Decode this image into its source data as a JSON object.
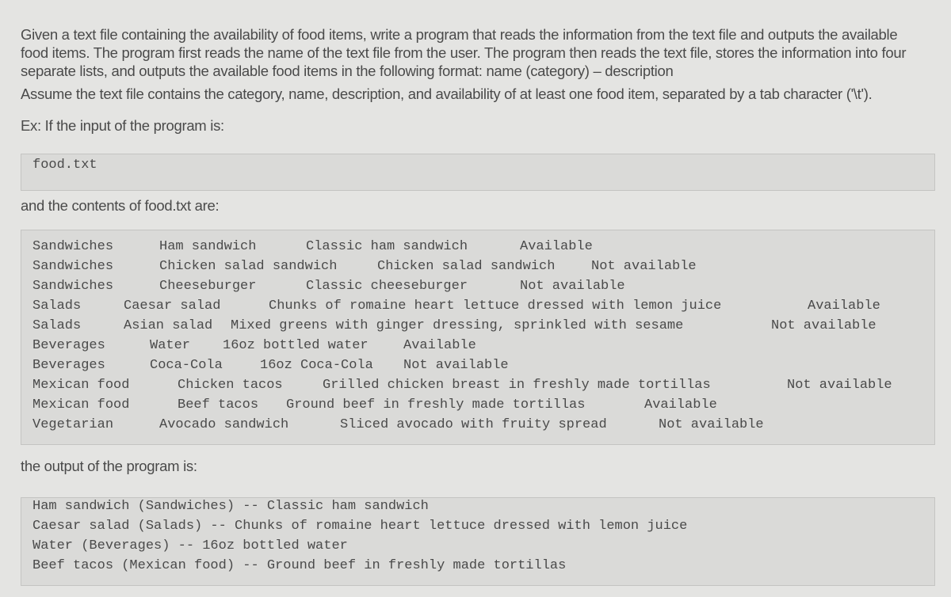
{
  "prompt": {
    "paragraph1": "Given a text file containing the availability of food items, write a program that reads the information from the text file and outputs the available food items. The program first reads the name of the text file from the user. The program then reads the text file, stores the information into four separate lists, and outputs the available food items in the following format: name (category) – description",
    "paragraph2": "Assume the text file contains the category, name, description, and availability of at least one food item, separated by a tab character ('\\t').",
    "paragraph3": "Ex: If the input of the program is:",
    "input_value": "food.txt",
    "contents_label": "and the contents of food.txt are:",
    "output_label": "the output of the program is:"
  },
  "file_lines": [
    [
      "Sandwiches",
      "Ham sandwich",
      "Classic ham sandwich",
      "Available"
    ],
    [
      "Sandwiches",
      "Chicken salad sandwich",
      "Chicken salad sandwich",
      "Not available"
    ],
    [
      "Sandwiches",
      "Cheeseburger",
      "Classic cheeseburger",
      "Not available"
    ],
    [
      "Salads",
      "Caesar salad",
      "Chunks of romaine heart lettuce dressed with lemon juice",
      "Available"
    ],
    [
      "Salads",
      "Asian salad",
      "Mixed greens with ginger dressing, sprinkled with sesame",
      "Not available"
    ],
    [
      "Beverages",
      "Water",
      "16oz bottled water",
      "Available"
    ],
    [
      "Beverages",
      "Coca-Cola",
      "16oz Coca-Cola",
      "Not available"
    ],
    [
      "Mexican food",
      "Chicken tacos",
      "Grilled chicken breast in freshly made tortillas",
      "Not available"
    ],
    [
      "Mexican food",
      "Beef tacos",
      "Ground beef in freshly made tortillas",
      "Available"
    ],
    [
      "Vegetarian",
      "Avocado sandwich",
      "Sliced avocado with fruity spread",
      "Not available"
    ]
  ],
  "output_lines": [
    "Ham sandwich (Sandwiches) -- Classic ham sandwich",
    "Caesar salad (Salads) -- Chunks of romaine heart lettuce dressed with lemon juice",
    "Water (Beverages) -- 16oz bottled water",
    "Beef tacos (Mexican food) -- Ground beef in freshly made tortillas"
  ]
}
